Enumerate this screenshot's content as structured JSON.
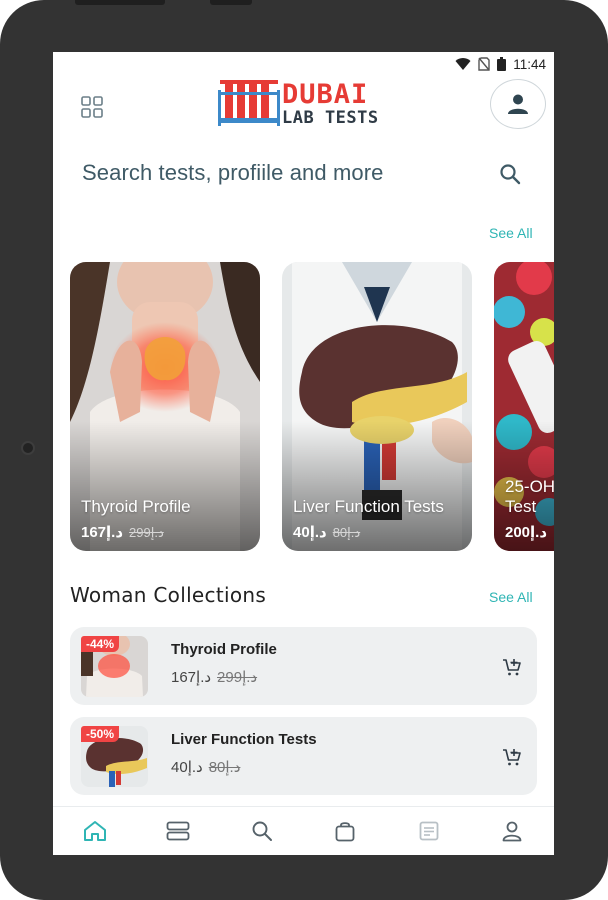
{
  "status_bar": {
    "time": "11:44"
  },
  "header": {
    "logo_line1": "DUBAI",
    "logo_line2": "LAB TESTS"
  },
  "search": {
    "placeholder": "Search tests, profiile and more"
  },
  "featured": {
    "see_all": "See All",
    "cards": [
      {
        "title": "Thyroid Profile",
        "price": "167د.إ",
        "old_price": "299د.إ"
      },
      {
        "title": "Liver Function Tests",
        "price": "40د.إ",
        "old_price": "80د.إ"
      },
      {
        "title": "25-OH Test",
        "price": "200د.إ"
      }
    ]
  },
  "woman_collections": {
    "title": "Woman Collections",
    "see_all": "See All",
    "items": [
      {
        "badge": "-44%",
        "name": "Thyroid Profile",
        "price": "167د.إ",
        "old_price": "299د.إ"
      },
      {
        "badge": "-50%",
        "name": "Liver Function Tests",
        "price": "40د.إ",
        "old_price": "80د.إ"
      }
    ]
  },
  "colors": {
    "accent": "#2fb5b4",
    "logo_red": "#e63b35",
    "badge_red": "#f04444",
    "search_text": "#3f5a66",
    "device_frame": "#333333"
  },
  "icons": {
    "status": [
      "wifi-icon",
      "no-sim-icon",
      "battery-icon"
    ],
    "header": [
      "grid-menu-icon",
      "user-icon",
      "search-icon"
    ],
    "cart": "add-to-cart-icon",
    "nav": [
      "home-icon",
      "categories-icon",
      "search-icon",
      "bag-icon",
      "receipt-icon",
      "profile-icon"
    ]
  }
}
